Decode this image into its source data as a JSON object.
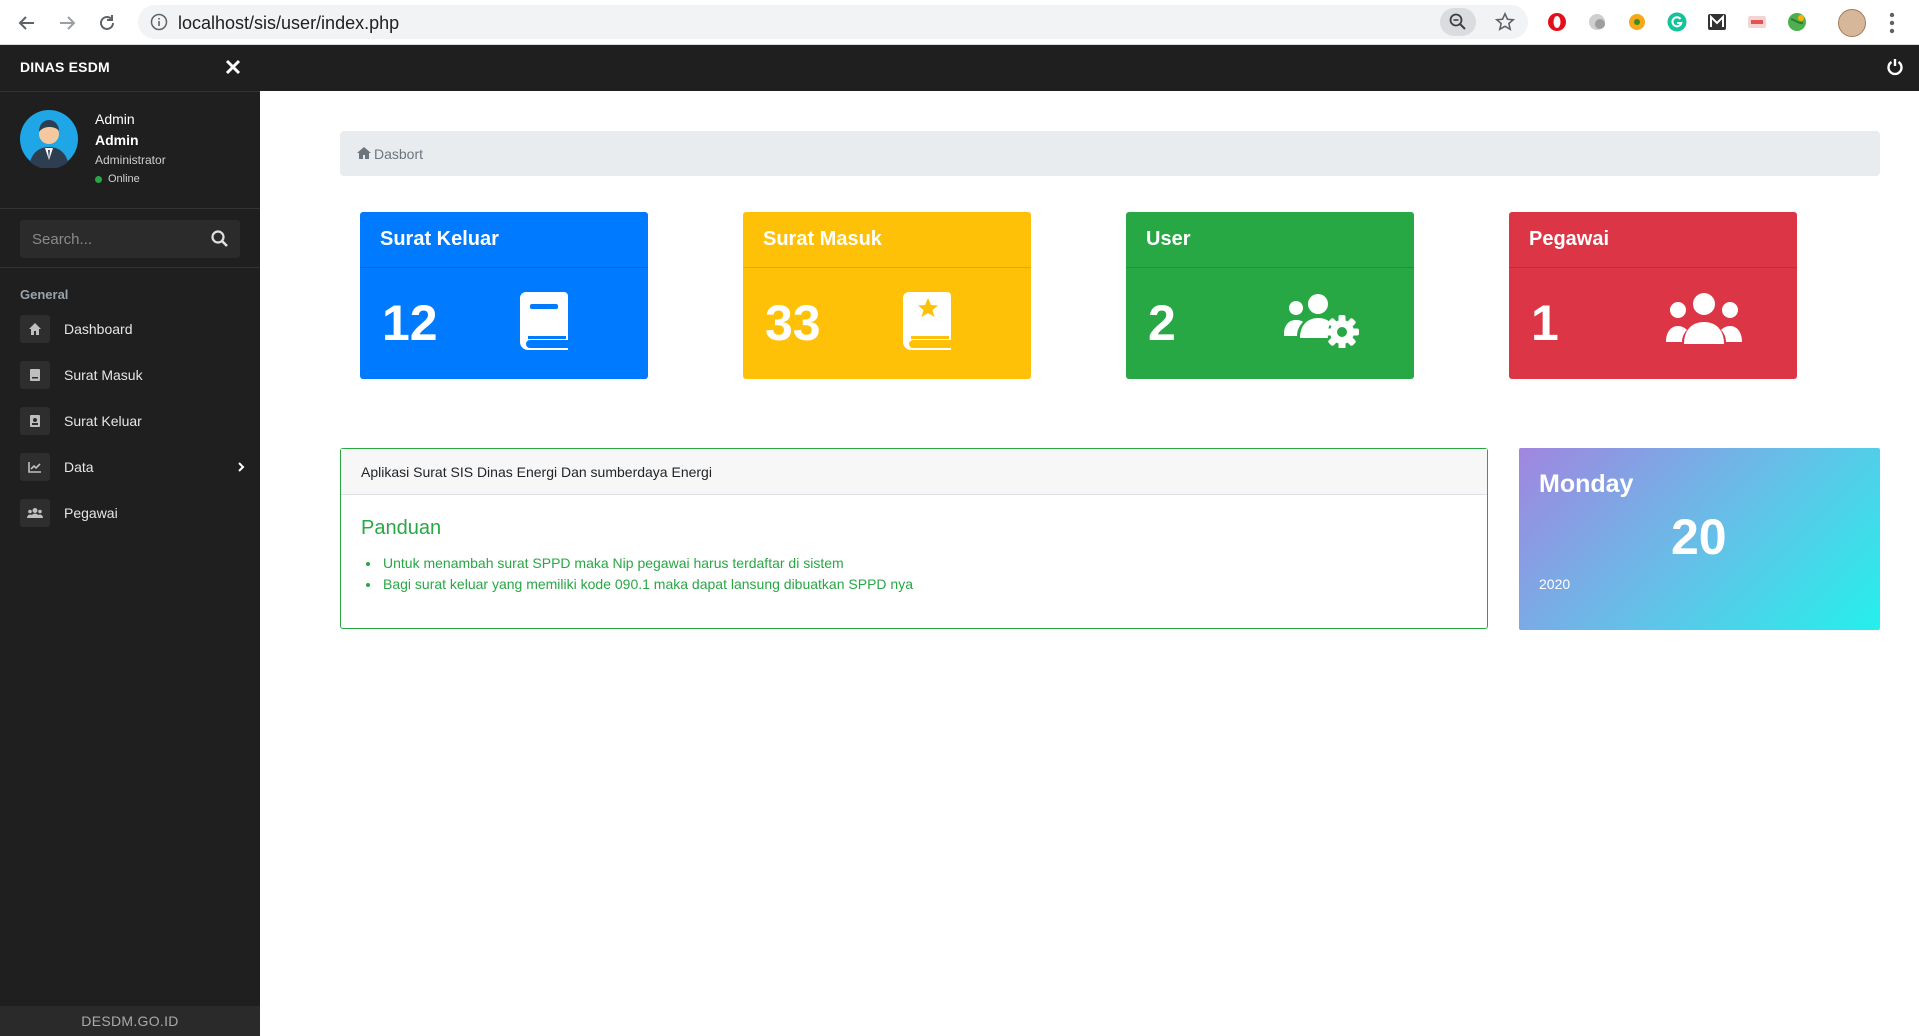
{
  "browser": {
    "url": "localhost/sis/user/index.php",
    "back_icon": "arrow-left-icon",
    "forward_icon": "arrow-right-icon",
    "reload_icon": "reload-icon"
  },
  "sidebar": {
    "brand": "DINAS ESDM",
    "user": {
      "name": "Admin",
      "full_name": "Admin",
      "role": "Administrator",
      "status": "Online"
    },
    "search": {
      "placeholder": "Search..."
    },
    "section_label": "General",
    "items": [
      {
        "label": "Dashboard",
        "icon": "home-icon"
      },
      {
        "label": "Surat Masuk",
        "icon": "book-icon"
      },
      {
        "label": "Surat Keluar",
        "icon": "contact-book-icon"
      },
      {
        "label": "Data",
        "icon": "chart-icon"
      },
      {
        "label": "Pegawai",
        "icon": "users-icon"
      }
    ],
    "footer": "DESDM.GO.ID"
  },
  "breadcrumb": {
    "label": "Dasbort"
  },
  "cards": [
    {
      "title": "Surat Keluar",
      "value": "12",
      "color": "#007bff",
      "icon": "book-icon"
    },
    {
      "title": "Surat Masuk",
      "value": "33",
      "color": "#ffc107",
      "icon": "book-star-icon"
    },
    {
      "title": "User",
      "value": "2",
      "color": "#28a745",
      "icon": "users-cog-icon"
    },
    {
      "title": "Pegawai",
      "value": "1",
      "color": "#dc3545",
      "icon": "users-icon"
    }
  ],
  "panel": {
    "header": "Aplikasi Surat SIS Dinas Energi Dan sumberdaya Energi",
    "title": "Panduan",
    "items": [
      "Untuk menambah surat SPPD maka Nip pegawai harus terdaftar di sistem",
      "Bagi surat keluar yang memiliki kode 090.1 maka dapat lansung dibuatkan SPPD nya"
    ]
  },
  "date_card": {
    "day": "Monday",
    "date": "20",
    "year": "2020"
  },
  "colors": {
    "sidebar_bg": "#1f1f1f",
    "accent_green": "#28a745"
  }
}
